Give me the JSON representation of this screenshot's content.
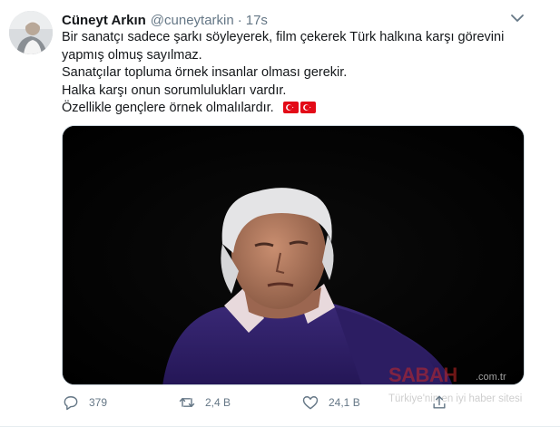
{
  "tweet": {
    "author_name": "Cüneyt Arkın",
    "handle": "@cuneytarkin",
    "separator": "·",
    "time": "17s",
    "text_lines": [
      "Bir sanatçı sadece şarkı söyleyerek, film çekerek Türk halkına karşı görevini",
      "yapmış olmuş sayılmaz.",
      "Sanatçılar topluma örnek insanlar olması gerekir.",
      "Halka karşı onun sorumlulukları vardır.",
      "Özellikle gençlere örnek olmalılardır."
    ],
    "emoji": [
      "turkey-flag",
      "turkey-flag"
    ]
  },
  "actions": {
    "replies": "379",
    "retweets": "2,4 B",
    "likes": "24,1 B"
  },
  "watermark": {
    "brand": "SABAH",
    "domain": ".com.tr",
    "tagline": "Türkiye'nin en iyi haber sitesi"
  },
  "colors": {
    "text": "#14171a",
    "secondary": "#657786",
    "flag_red": "#e30a17"
  }
}
